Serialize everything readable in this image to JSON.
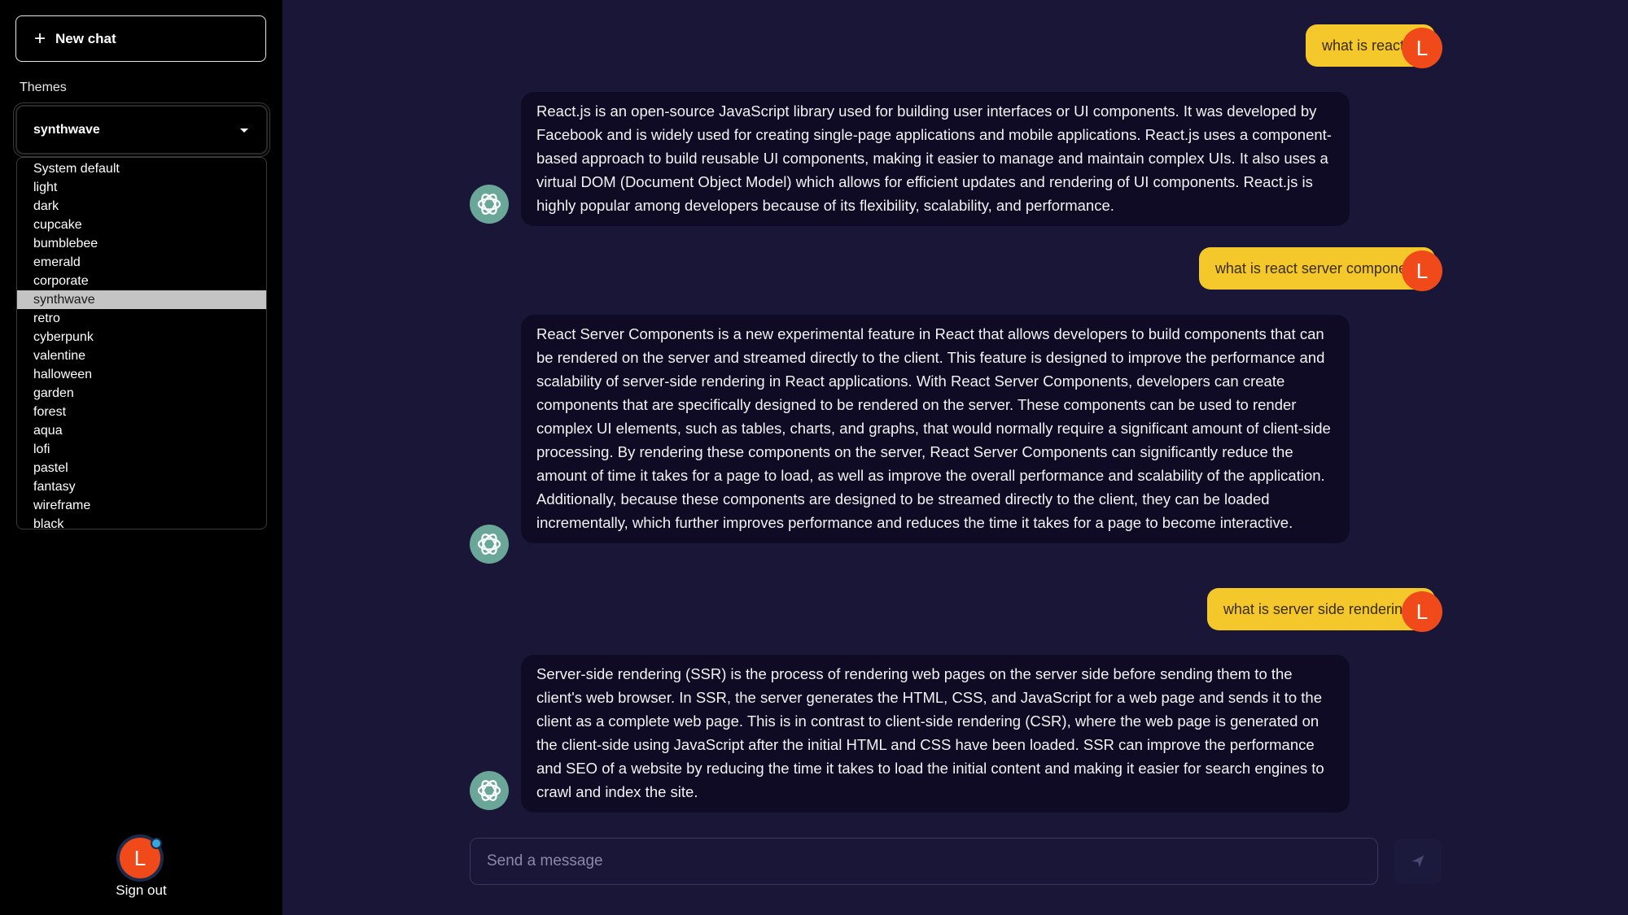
{
  "sidebar": {
    "new_chat_label": "New chat",
    "themes_label": "Themes",
    "selected_theme": "synthwave",
    "theme_options": [
      "System default",
      "light",
      "dark",
      "cupcake",
      "bumblebee",
      "emerald",
      "corporate",
      "synthwave",
      "retro",
      "cyberpunk",
      "valentine",
      "halloween",
      "garden",
      "forest",
      "aqua",
      "lofi",
      "pastel",
      "fantasy",
      "wireframe",
      "black"
    ],
    "user_initial": "L",
    "sign_out_label": "Sign out"
  },
  "chat": {
    "messages": [
      {
        "role": "user",
        "text": "what is react js"
      },
      {
        "role": "assistant",
        "text": "React.js is an open-source JavaScript library used for building user interfaces or UI components. It was developed by Facebook and is widely used for creating single-page applications and mobile applications. React.js uses a component-based approach to build reusable UI components, making it easier to manage and maintain complex UIs. It also uses a virtual DOM (Document Object Model) which allows for efficient updates and rendering of UI components. React.js is highly popular among developers because of its flexibility, scalability, and performance."
      },
      {
        "role": "user",
        "text": "what is react server component"
      },
      {
        "role": "assistant",
        "text": "React Server Components is a new experimental feature in React that allows developers to build components that can be rendered on the server and streamed directly to the client. This feature is designed to improve the performance and scalability of server-side rendering in React applications. With React Server Components, developers can create components that are specifically designed to be rendered on the server. These components can be used to render complex UI elements, such as tables, charts, and graphs, that would normally require a significant amount of client-side processing. By rendering these components on the server, React Server Components can significantly reduce the amount of time it takes for a page to load, as well as improve the overall performance and scalability of the application. Additionally, because these components are designed to be streamed directly to the client, they can be loaded incrementally, which further improves performance and reduces the time it takes for a page to become interactive."
      },
      {
        "role": "user",
        "text": "what is server side rendering?"
      },
      {
        "role": "assistant",
        "text": "Server-side rendering (SSR) is the process of rendering web pages on the server side before sending them to the client's web browser. In SSR, the server generates the HTML, CSS, and JavaScript for a web page and sends it to the client as a complete web page. This is in contrast to client-side rendering (CSR), where the web page is generated on the client-side using JavaScript after the initial HTML and CSS have been loaded. SSR can improve the performance and SEO of a website by reducing the time it takes to load the initial content and making it easier for search engines to crawl and index the site."
      }
    ],
    "user_initial": "L"
  },
  "composer": {
    "placeholder": "Send a message"
  },
  "colors": {
    "background": "#1a1638",
    "sidebar": "#000000",
    "user_bubble": "#f4c82a",
    "bot_bubble": "#100b24",
    "avatar": "#f04a1a",
    "bot_avatar": "#6aa798"
  },
  "icons": {
    "new_chat": "plus-icon",
    "dropdown": "caret-down-icon",
    "assistant": "openai-logo-icon",
    "send": "send-icon"
  }
}
